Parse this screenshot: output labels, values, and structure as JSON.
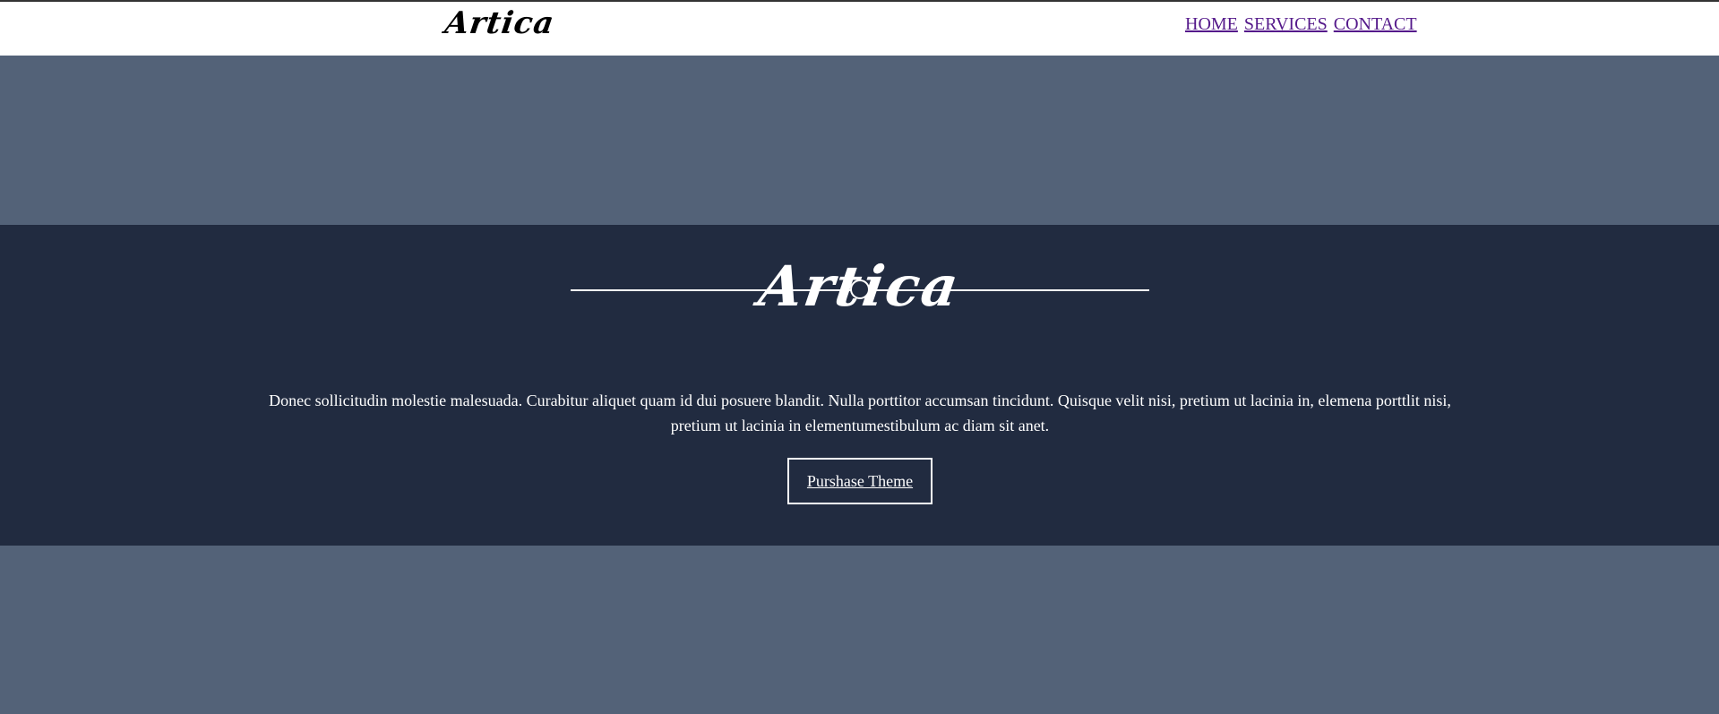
{
  "header": {
    "logo_text": "Artica",
    "nav": [
      {
        "label": "HOME"
      },
      {
        "label": "SERVICES"
      },
      {
        "label": "CONTACT"
      }
    ]
  },
  "hero": {
    "title": "Artica",
    "description": "Donec sollicitudin molestie malesuada. Curabitur aliquet quam id dui posuere blandit. Nulla porttitor accumsan tincidunt. Quisque velit nisi, pretium ut lacinia in, elemena porttlit nisi, pretium ut lacinia in elementumestibulum ac diam sit anet.",
    "cta_label": "Purshase Theme"
  },
  "colors": {
    "page_background": "#536278",
    "hero_background": "#212b40",
    "topbar_background": "#ffffff",
    "nav_link": "#551a8b"
  }
}
